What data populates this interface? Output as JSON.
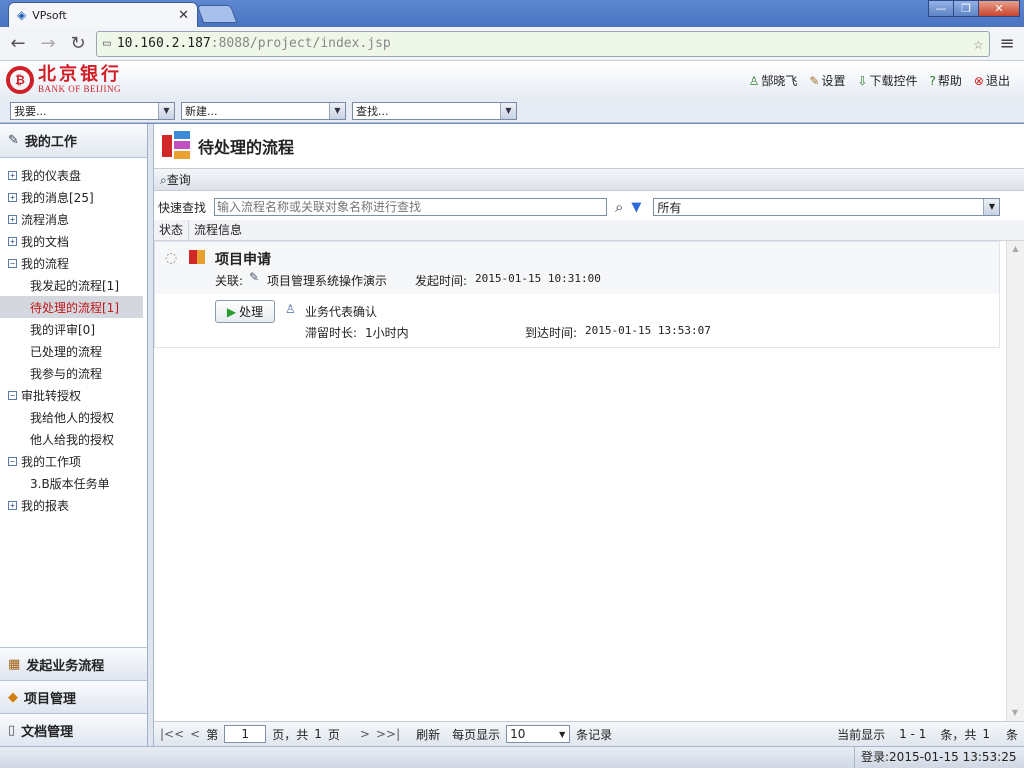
{
  "browser": {
    "tab_title": "VPsoft",
    "url_host": "10.160.2.187",
    "url_path": ":8088/project/index.jsp"
  },
  "app": {
    "logo_cn": "北京银行",
    "logo_en": "BANK OF BEIJING",
    "header_links": [
      "郜晓飞",
      "设置",
      "下载控件",
      "帮助",
      "退出"
    ]
  },
  "combos": [
    "我要...",
    "新建...",
    "查找..."
  ],
  "sidebar": {
    "header": "我的工作",
    "items": [
      {
        "label": "我的仪表盘",
        "level": 0,
        "box": "+"
      },
      {
        "label": "我的消息[25]",
        "level": 0,
        "box": "+"
      },
      {
        "label": "流程消息",
        "level": 0,
        "box": "+"
      },
      {
        "label": "我的文档",
        "level": 0,
        "box": "+"
      },
      {
        "label": "我的流程",
        "level": 0,
        "box": "−"
      },
      {
        "label": "我发起的流程[1]",
        "level": 1
      },
      {
        "label": "待处理的流程[1]",
        "level": 1,
        "selected": true
      },
      {
        "label": "我的评审[0]",
        "level": 1
      },
      {
        "label": "已处理的流程",
        "level": 1
      },
      {
        "label": "我参与的流程",
        "level": 1
      },
      {
        "label": "审批转授权",
        "level": 0,
        "box": "−"
      },
      {
        "label": "我给他人的授权",
        "level": 1
      },
      {
        "label": "他人给我的授权",
        "level": 1
      },
      {
        "label": "我的工作项",
        "level": 0,
        "box": "−"
      },
      {
        "label": "3.B版本任务单",
        "level": 1
      },
      {
        "label": "我的报表",
        "level": 0,
        "box": "+"
      }
    ],
    "bottom": [
      "发起业务流程",
      "项目管理",
      "文档管理"
    ]
  },
  "main": {
    "title": "待处理的流程",
    "query_label": "查询",
    "fast_label": "快速查找",
    "fast_placeholder": "输入流程名称或关联对象名称进行查找",
    "filter_value": "所有",
    "columns": [
      "状态",
      "流程信息"
    ],
    "record": {
      "name": "项目申请",
      "assoc_label": "关联:",
      "assoc_value": "项目管理系统操作演示",
      "start_label": "发起时间:",
      "start_value": "2015-01-15 10:31:00",
      "action_label": "处理",
      "task_name": "业务代表确认",
      "stay_label": "滞留时长:",
      "stay_value": "1小时内",
      "arrive_label": "到达时间:",
      "arrive_value": "2015-01-15 13:53:07"
    },
    "pager": {
      "first": "|<<",
      "prev": "<",
      "page_prefix": "第",
      "page_value": "1",
      "page_suffix_a": "页，共",
      "total_pages": "1",
      "page_suffix_b": "页",
      "next": ">",
      "last": ">>|",
      "refresh": "刷新",
      "per_page_label": "每页显示",
      "per_page_value": "10",
      "records_label": "条记录",
      "showing_label": "当前显示",
      "showing_range": "1 - 1",
      "total_label": "条，共",
      "total_value": "1",
      "total_unit": "条"
    }
  },
  "status": {
    "login": "登录:2015-01-15 13:53:25"
  }
}
